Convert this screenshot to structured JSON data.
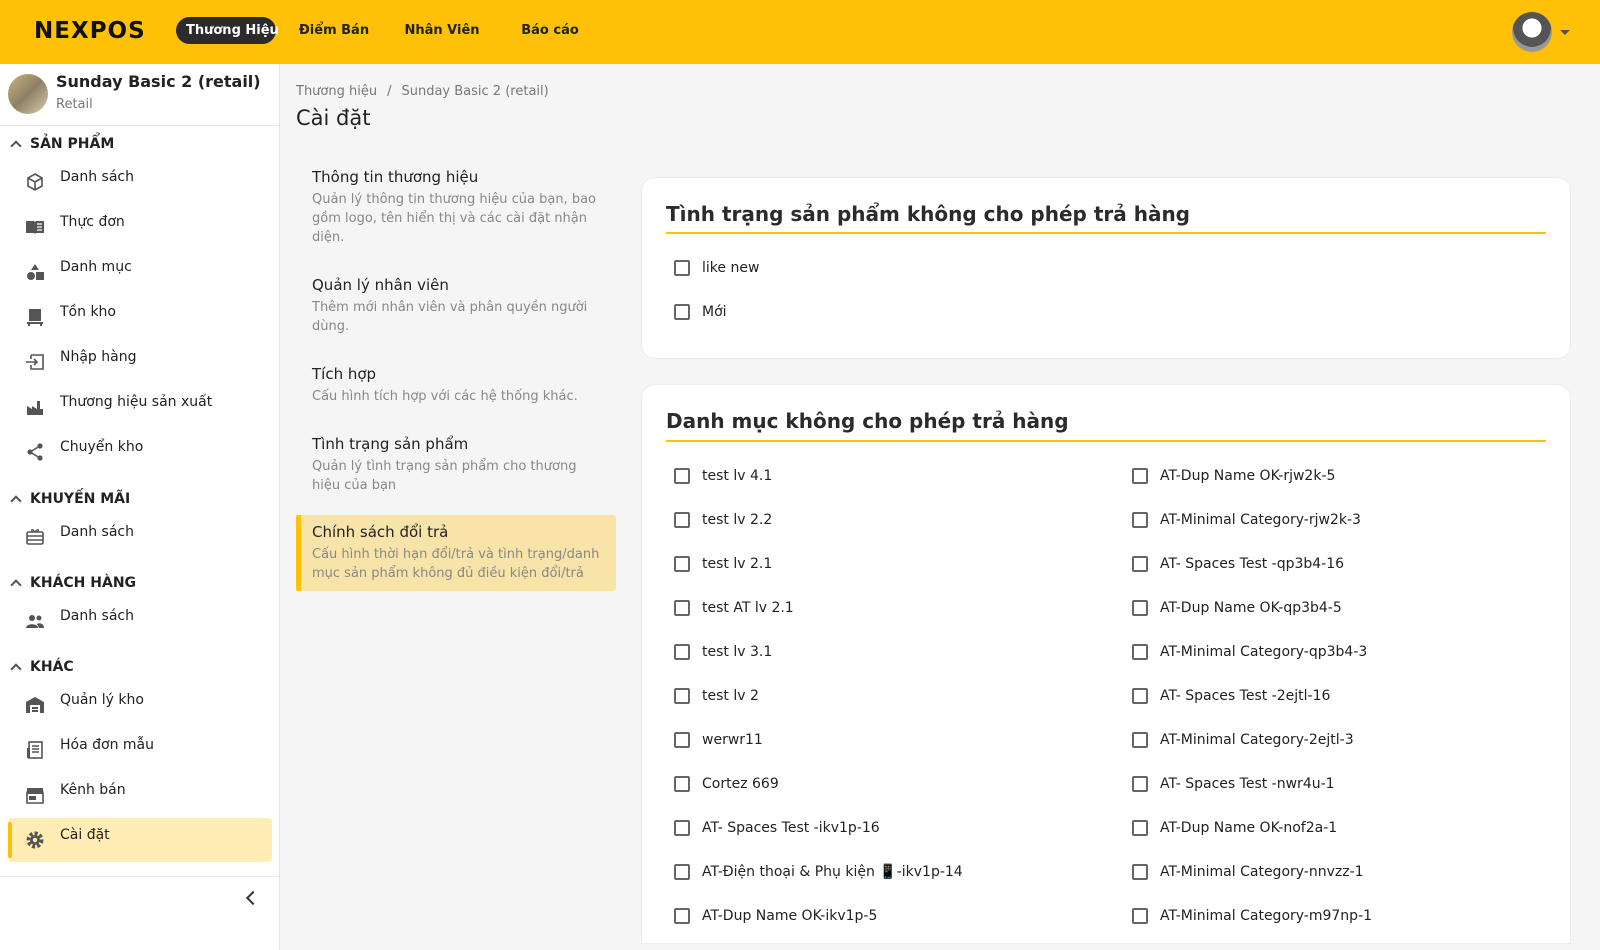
{
  "topbar": {
    "logo": "NEXPOS",
    "nav": [
      "Thương Hiệu",
      "Điểm Bán",
      "Nhân Viên",
      "Báo cáo"
    ]
  },
  "brand": {
    "name": "Sunday Basic 2 (retail)",
    "type": "Retail"
  },
  "sidebar": {
    "sections": [
      {
        "title": "SẢN PHẨM",
        "items": [
          "Danh sách",
          "Thực đơn",
          "Danh mục",
          "Tồn kho",
          "Nhập hàng",
          "Thương hiệu sản xuất",
          "Chuyển kho"
        ]
      },
      {
        "title": "KHUYẾN MÃI",
        "items": [
          "Danh sách"
        ]
      },
      {
        "title": "KHÁCH HÀNG",
        "items": [
          "Danh sách"
        ]
      },
      {
        "title": "KHÁC",
        "items": [
          "Quản lý kho",
          "Hóa đơn mẫu",
          "Kênh bán",
          "Cài đặt"
        ]
      }
    ]
  },
  "breadcrumb": [
    "Thương hiệu",
    "/",
    "Sunday Basic 2 (retail)"
  ],
  "page_title": "Cài đặt",
  "settings_nav": [
    {
      "title": "Thông tin thương hiệu",
      "desc": "Quản lý thông tin thương hiệu của bạn, bao gồm logo, tên hiển thị và các cài đặt nhận diện."
    },
    {
      "title": "Quản lý nhân viên",
      "desc": "Thêm mới nhân viên và phân quyền người dùng."
    },
    {
      "title": "Tích hợp",
      "desc": "Cấu hình tích hợp với các hệ thống khác."
    },
    {
      "title": "Tình trạng sản phẩm",
      "desc": "Quản lý tình trạng sản phẩm cho thương hiệu của bạn"
    },
    {
      "title": "Chính sách đổi trả",
      "desc": "Cấu hình thời hạn đổi/trả và tình trạng/danh mục sản phẩm không đủ điều kiện đổi/trả"
    }
  ],
  "card_condition": {
    "title": "Tình trạng sản phẩm không cho phép trả hàng",
    "options": [
      "like new",
      "Mới"
    ]
  },
  "card_category": {
    "title": "Danh mục không cho phép trả hàng",
    "left": [
      "test lv 4.1",
      "test lv 2.2",
      "test lv 2.1",
      "test AT lv 2.1",
      "test lv 3.1",
      "test lv 2",
      "werwr11",
      "Cortez 669",
      "AT- Spaces Test -ikv1p-16",
      "AT-Điện thoại & Phụ kiện 📱-ikv1p-14",
      "AT-Dup Name OK-ikv1p-5"
    ],
    "right": [
      "AT-Dup Name OK-rjw2k-5",
      "AT-Minimal Category-rjw2k-3",
      "AT- Spaces Test -qp3b4-16",
      "AT-Dup Name OK-qp3b4-5",
      "AT-Minimal Category-qp3b4-3",
      "AT- Spaces Test -2ejtl-16",
      "AT-Minimal Category-2ejtl-3",
      "AT- Spaces Test -nwr4u-1",
      "AT-Dup Name OK-nof2a-1",
      "AT-Minimal Category-nnvzz-1",
      "AT-Minimal Category-m97np-1"
    ]
  },
  "colors": {
    "accent": "#ffc107",
    "active_bg": "#ffedb3"
  }
}
